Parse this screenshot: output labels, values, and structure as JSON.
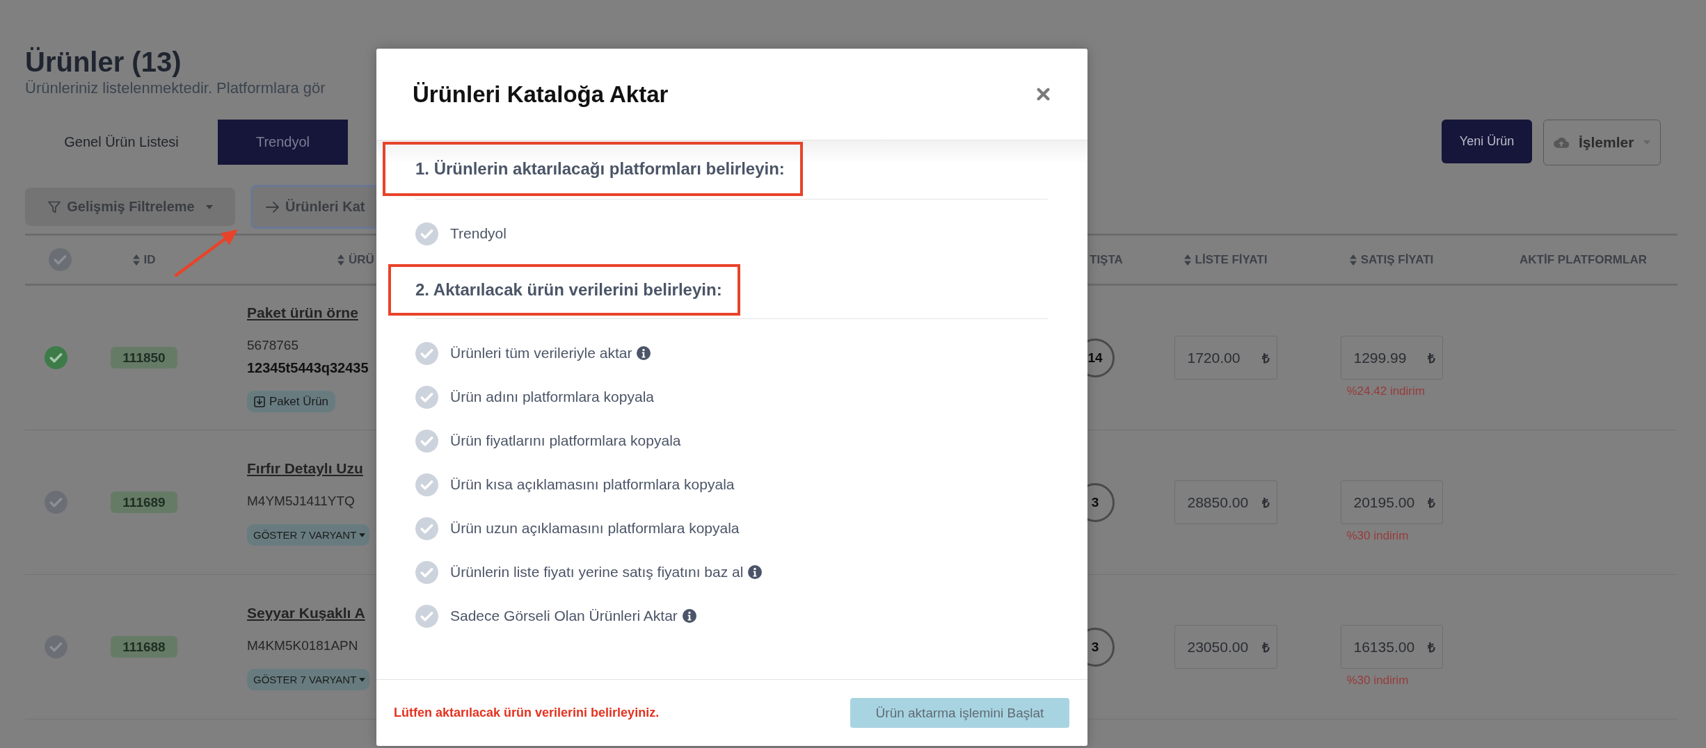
{
  "page": {
    "title": "Ürünler (13)",
    "subtitle": "Ürünleriniz listelenmektedir. Platformlara gör"
  },
  "tabs": [
    {
      "label": "Genel Ürün Listesi",
      "selected": false
    },
    {
      "label": "Trendyol",
      "selected": true
    }
  ],
  "actions": [
    {
      "kind": "primary",
      "label": "Yeni Ürün"
    },
    {
      "kind": "menu",
      "label": "İşlemler"
    }
  ],
  "toolbar": [
    {
      "kind": "filter",
      "label": "Gelişmiş Filtreleme",
      "focused": false
    },
    {
      "kind": "export",
      "label": "Ürünleri Kat",
      "focused": true
    }
  ],
  "table": {
    "select_all_checked": false,
    "columns": [
      {
        "label": "ID",
        "sortable": true
      },
      {
        "label": "ÜRÜ",
        "sortable": true
      },
      {
        "label": "TIŞTA",
        "sortable": false
      },
      {
        "label": "LİSTE FİYATI",
        "sortable": true
      },
      {
        "label": "SATIŞ FİYATI",
        "sortable": true
      },
      {
        "label": "AKTİF PLATFORMLAR",
        "sortable": false
      }
    ],
    "rows": [
      {
        "checked": true,
        "id": "111850",
        "name": "Paket ürün örne",
        "sku": "5678765",
        "code": "12345t5443q32435",
        "tag": {
          "kind": "bundle",
          "label": "Paket Ürün"
        },
        "count": "14",
        "list_price": {
          "value": "1720.00",
          "currency": "₺"
        },
        "sale_price": {
          "value": "1299.99",
          "currency": "₺"
        },
        "discount": "%24.42 indirim"
      },
      {
        "checked": false,
        "id": "111689",
        "name": "Fırfır Detaylı Uzu",
        "sku": "M4YM5J1411YTQ",
        "tag": {
          "kind": "variants",
          "label": "GÖSTER 7 VARYANT"
        },
        "count": "3",
        "list_price": {
          "value": "28850.00",
          "currency": "₺"
        },
        "sale_price": {
          "value": "20195.00",
          "currency": "₺"
        },
        "discount": "%30 indirim"
      },
      {
        "checked": false,
        "id": "111688",
        "name": "Seyyar Kuşaklı A",
        "sku": "M4KM5K0181APN",
        "tag": {
          "kind": "variants",
          "label": "GÖSTER 7 VARYANT"
        },
        "count": "3",
        "list_price": {
          "value": "23050.00",
          "currency": "₺"
        },
        "sale_price": {
          "value": "16135.00",
          "currency": "₺"
        },
        "discount": "%30 indirim"
      }
    ]
  },
  "modal": {
    "title": "Ürünleri Kataloğa Aktar",
    "sections": [
      {
        "heading": "1. Ürünlerin aktarılacağı platformları belirleyin:",
        "highlighted": true,
        "options": [
          {
            "label": "Trendyol",
            "checked": false,
            "info": false
          }
        ]
      },
      {
        "heading": "2. Aktarılacak ürün verilerini belirleyin:",
        "highlighted": true,
        "options": [
          {
            "label": "Ürünleri tüm verileriyle aktar",
            "checked": false,
            "info": true
          },
          {
            "label": "Ürün adını platformlara kopyala",
            "checked": false,
            "info": false
          },
          {
            "label": "Ürün fiyatlarını platformlara kopyala",
            "checked": false,
            "info": false
          },
          {
            "label": "Ürün kısa açıklamasını platformlara kopyala",
            "checked": false,
            "info": false
          },
          {
            "label": "Ürün uzun açıklamasını platformlara kopyala",
            "checked": false,
            "info": false
          },
          {
            "label": "Ürünlerin liste fiyatı yerine satış fiyatını baz al",
            "checked": false,
            "info": true
          },
          {
            "label": "Sadece Görseli Olan Ürünleri Aktar",
            "checked": false,
            "info": true
          }
        ]
      }
    ],
    "footer": {
      "message": "Lütfen aktarılacak ürün verilerini belirleyiniz.",
      "button": {
        "label": "Ürün aktarma işlemini Başlat",
        "disabled": true
      }
    }
  }
}
